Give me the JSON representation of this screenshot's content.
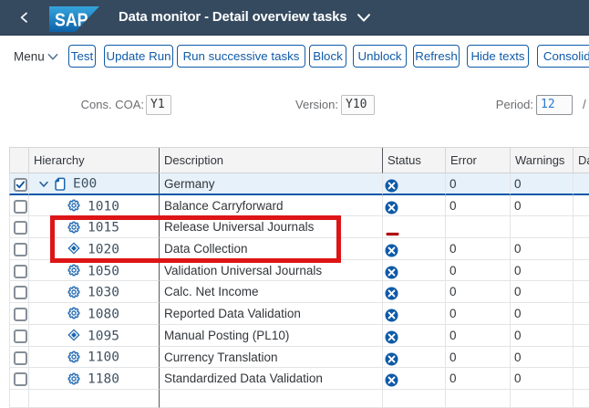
{
  "shell": {
    "logo_text": "SAP",
    "title": "Data monitor - Detail overview tasks"
  },
  "toolbar": {
    "menu_label": "Menu",
    "buttons": [
      "Test",
      "Update Run",
      "Run successive tasks",
      "Block",
      "Unblock",
      "Refresh",
      "Hide texts",
      "Consolidate"
    ]
  },
  "filters": [
    {
      "label": "Cons. COA:",
      "value": "Y1"
    },
    {
      "label": "Version:",
      "value": "Y10"
    },
    {
      "label": "Period:",
      "value": "12",
      "suffix": "/"
    }
  ],
  "table": {
    "columns": {
      "hierarchy": "Hierarchy",
      "description": "Description",
      "status": "Status",
      "error": "Error",
      "warnings": "Warnings",
      "last": "Da"
    },
    "rows": [
      {
        "id": "E00",
        "description": "Germany",
        "icon": "node",
        "expanded": true,
        "checked": true,
        "selected": true,
        "status": "x",
        "error": "0",
        "warnings": "0"
      },
      {
        "id": "1010",
        "description": "Balance Carryforward",
        "icon": "gear",
        "status": "x",
        "error": "0",
        "warnings": "0"
      },
      {
        "id": "1015",
        "description": "Release Universal Journals",
        "icon": "gear",
        "status": "dash",
        "error": "",
        "warnings": ""
      },
      {
        "id": "1020",
        "description": "Data Collection",
        "icon": "diamond",
        "status": "x",
        "error": "0",
        "warnings": "0"
      },
      {
        "id": "1050",
        "description": "Validation Universal Journals",
        "icon": "gear",
        "status": "x",
        "error": "0",
        "warnings": "0"
      },
      {
        "id": "1030",
        "description": "Calc. Net Income",
        "icon": "gear",
        "status": "x",
        "error": "0",
        "warnings": "0"
      },
      {
        "id": "1080",
        "description": "Reported Data Validation",
        "icon": "gear",
        "status": "x",
        "error": "0",
        "warnings": "0"
      },
      {
        "id": "1095",
        "description": "Manual Posting (PL10)",
        "icon": "diamond",
        "status": "x",
        "error": "0",
        "warnings": "0"
      },
      {
        "id": "1100",
        "description": "Currency Translation",
        "icon": "gear",
        "status": "x",
        "error": "0",
        "warnings": "0"
      },
      {
        "id": "1180",
        "description": "Standardized Data Validation",
        "icon": "gear",
        "status": "x",
        "error": "0",
        "warnings": "0"
      }
    ]
  },
  "annotation": {
    "shape": "rectangle",
    "color": "#dd1516"
  },
  "colors": {
    "shell_bar": "#354a5f",
    "button_blue": "#0f5ba9",
    "status_blue": "#0e5aa7",
    "status_dash_red": "#b00e12",
    "selected_row_bg": "#e7f1fa",
    "annotation_red": "#dd1516"
  }
}
